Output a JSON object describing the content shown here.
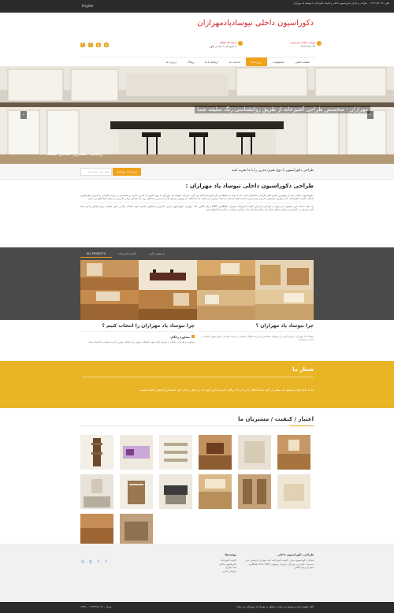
{
  "topbar": {
    "text": "تلفن: ۰۹۱۲۳۱۸۶۰۹۷ - طراحی و اجرای دکوراسیون داخلی و کابینت آشپزخانه با نیوساد پاد مهرازان",
    "lang": "English"
  },
  "header": {
    "title": "دکوراسیون داخلی نیوسادپادمهرازان",
    "contact1": {
      "title": "تهران، خیابان فردوسی",
      "line": "۰۹۱۲۳۱۸۶۰۹۷"
    },
    "contact2": {
      "title": "جمعه ها تعطیل",
      "line": "۸ صبح الی ۶ بعد از ظهر"
    }
  },
  "nav": {
    "items": [
      "صفحه اصلی",
      "محصولات",
      "پروژه ها",
      "خدمات ما",
      "ارتباط با ما",
      "وبلاگ",
      "درباره ما"
    ]
  },
  "slider": {
    "caption": "مهرازان : متخصص طراحی آشپزخانه از طریق روانشناسی رنگ سلیقه شما",
    "caption2": "رضایت مشتری اتفاقی نیست ..."
  },
  "newsletter": {
    "text": "طراحی دکوراسیون با ذوق هنری مدرن را با ما تجربه کنید",
    "placeholder": "ایمیل خود را وارد کنید",
    "button": "نیوساد پاد مهرازان"
  },
  "intro": {
    "heading": "طراحی دکوراسیون داخلی نیوساد پاد مهرازان :",
    "p1": "دکوراسیون داخلی یکی از مهمترین بخش های طراحی ساختمان است که با توجه به سلیقه و نیاز کارفرما انجام می گیرد. شرکت نیوساد پاد مهرازان با بهره گیری از کادری مجرب و متخصص در زمینه طراحی و اجرای دکوراسیون داخلی، کابینت آشپزخانه، کمد دیواری، پارتیشن اداری و میز مدیریت آماده ارائه خدمات به شما عزیزان می باشد. ما با استفاده از بهترین متریال ها و جدیدترین متدهای روز دنیا، فضایی زیبا و کاربردی را برای شما خلق می کنیم.",
    "p2": "از جمله خدمات این مجموعه می توان به طراحی و اجرای کابینت آشپزخانه ممبران، هایگلاس، MDF و پلی گلاس، کمد دیواری، دکوراسیون اداری، تجاری و مسکونی اشاره نمود. انتخاب رنگ و جنس مناسب برای فضای زندگی شما تاثیر بسزایی در آرامش و رضایت خاطر شما دارد و کارشناسان ما در تمامی مراحل در کنار شما خواهند بود."
  },
  "projects": {
    "tabs": [
      "ALL PROJECTS",
      "کابینت آشپزخانه",
      "پارتیشن اداری"
    ]
  },
  "why": {
    "title_right": "چرا نیوساد پاد مهرازان ؟",
    "text_right": "نیوساد پاد مهرازان با بهره گیری از نیروهای متخصص و تجربه سالیان متمادی در زمینه طراحی دکوراسیون داخلی در خدمت شماست.",
    "title_left": "چرا نیوساد پاد مهرازان را انتخاب کنیم ؟",
    "sub_left": "مشاوره رایگان",
    "text_left": "مشاوره و طراحی رایگان به همراه ارائه نمونه کارهای متنوع برای انتخاب بهترین گزینه متناسب با فضای شما."
  },
  "slogan": {
    "title": "شعار ما",
    "text": "ما به شما قول میدهیم که بیشتر از آنچه شما انتظار دارید از ما دریافت کنید و کاری کنیم که در محل زندگی خود احساس آرامش داشته باشید..."
  },
  "gallery": {
    "title": "اعتبار / کیفیت / مشتریان ما"
  },
  "footer": {
    "col1_title": "طراحی دکوراسیون داخلی",
    "col1_text": "شامل: دکوراسیون منزل، کابینت آشپزخانه، کمد دیواری، پارتیشن، میز مدیریت، کانتر، تی وی وال، جزیره، روشویی PVC، MDF، هایگلاس، ممبران و پلی گلاس",
    "col2_title": "نوشته‌ها",
    "col2_items": [
      "کابینت آشپزخانه",
      "دکوراسیون داخلی",
      "کمد دیواری",
      "پارتیشن اداری"
    ]
  },
  "bottombar": {
    "right": "کلیه حقوق مادی و معنوی این سایت متعلق به نیوساد پاد مهرازان می باشد",
    "left": "تهران - ۰۹۱۲۳۱۸۶۰۹۷ - ۱۳۹۸"
  },
  "colors": {
    "accent": "#f0a21a",
    "title_red": "#d3282c",
    "dark_bar": "#2b2b2b",
    "slogan_bg": "#e9b527"
  }
}
